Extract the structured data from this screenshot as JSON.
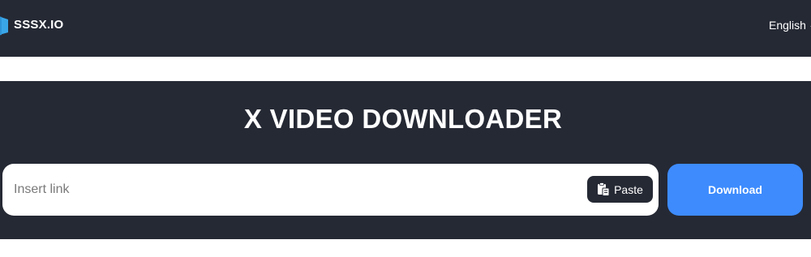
{
  "header": {
    "brand_name": "SSSX.IO",
    "logo_icon": "hexagon-logo-icon",
    "language_label": "English",
    "language_icon": "chevron-up-icon"
  },
  "hero": {
    "title": "X VIDEO DOWNLOADER",
    "input_placeholder": "Insert link",
    "input_value": "",
    "paste_label": "Paste",
    "paste_icon": "clipboard-icon",
    "download_label": "Download"
  },
  "colors": {
    "dark_bg": "#252934",
    "accent": "#3d8bfd",
    "logo": "#39a6e8"
  }
}
